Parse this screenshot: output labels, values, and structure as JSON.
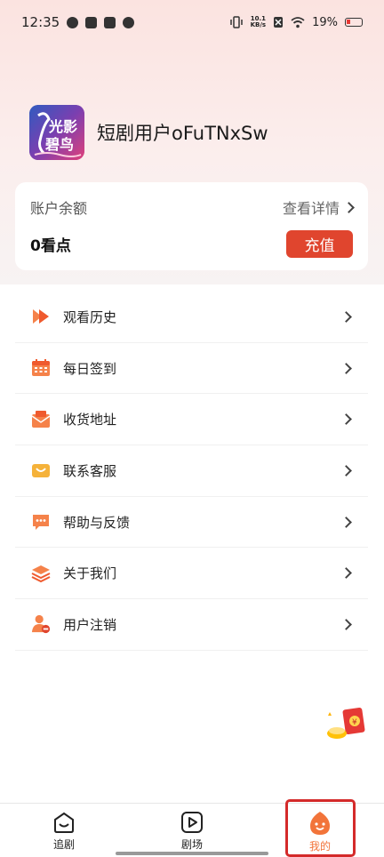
{
  "status_bar": {
    "time": "12:35",
    "net_speed_value": "10.1",
    "net_speed_unit": "KB/s",
    "battery": "19%"
  },
  "profile": {
    "username": "短剧用户oFuTNxSw",
    "avatar_logo_text": "光影 碧鸟"
  },
  "wallet": {
    "label": "账户余额",
    "detail_label": "查看详情",
    "balance": "0看点",
    "recharge_label": "充值"
  },
  "menu": {
    "items": [
      {
        "label": "观看历史",
        "icon": "play-history-icon"
      },
      {
        "label": "每日签到",
        "icon": "calendar-icon"
      },
      {
        "label": "收货地址",
        "icon": "envelope-icon"
      },
      {
        "label": "联系客服",
        "icon": "customer-service-icon"
      },
      {
        "label": "帮助与反馈",
        "icon": "chat-bubble-icon"
      },
      {
        "label": "关于我们",
        "icon": "layers-icon"
      },
      {
        "label": "用户注销",
        "icon": "user-remove-icon"
      }
    ]
  },
  "tabbar": {
    "tabs": [
      {
        "label": "追剧",
        "icon": "follow-drama-icon"
      },
      {
        "label": "剧场",
        "icon": "theater-play-icon"
      },
      {
        "label": "我的",
        "icon": "mine-face-icon",
        "active": true
      }
    ]
  },
  "colors": {
    "accent": "#e0452e",
    "tab_active": "#f2743a",
    "highlight_frame": "#d42a2a"
  }
}
